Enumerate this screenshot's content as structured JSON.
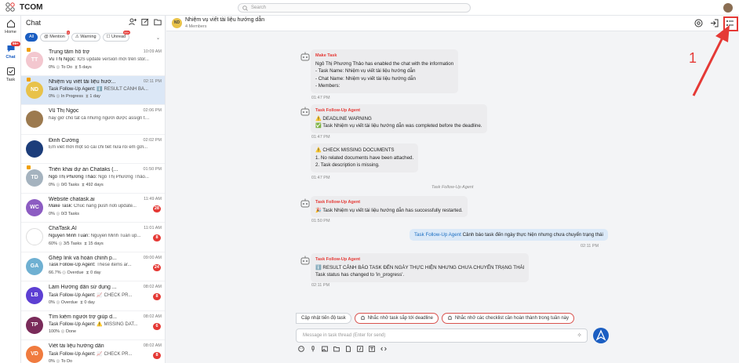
{
  "app": {
    "name": "TCOM",
    "search_placeholder": "Search"
  },
  "rail": [
    {
      "label": "Home"
    },
    {
      "label": "Chat",
      "badge": "99+"
    },
    {
      "label": "Task"
    }
  ],
  "sidebar": {
    "title": "Chat",
    "filters": [
      {
        "label": "All"
      },
      {
        "label": "Mention",
        "count": "0"
      },
      {
        "label": "Warning"
      },
      {
        "label": "Unread",
        "count": "99+"
      }
    ],
    "conversations": [
      {
        "initials": "TT",
        "color": "#f3c7cf",
        "name": "Trung tâm hỗ trợ",
        "time": "10:09 AM",
        "sender": "Vũ Thị Ngọc:",
        "preview": "IOS update version mới trên stor...",
        "pct": "0%",
        "status": "To Do",
        "due": "5 days"
      },
      {
        "initials": "ND",
        "color": "#e8c24a",
        "name": "Nhiệm vụ viết tài liệu hướ...",
        "time": "02:11 PM",
        "sender": "Task Follow-Up Agent:",
        "preview": "ℹ️ RESULT CẢNH BÁ...",
        "pct": "0%",
        "status": "In Progress",
        "due": "1 day"
      },
      {
        "initials": "",
        "color": "#9c7a4f",
        "name": "Vũ Thị Ngọc",
        "time": "02:06 PM",
        "sender": "",
        "preview": "hay giờ cho tất cả những người được assign tro...",
        "pct": "",
        "status": "",
        "due": ""
      },
      {
        "initials": "",
        "color": "#1c3d7a",
        "name": "Đinh Cường",
        "time": "02:02 PM",
        "sender": "",
        "preview": "Em viết mới một số cái chi tiết nữa rồi em gửi...",
        "pct": "",
        "status": "",
        "due": ""
      },
      {
        "initials": "TD",
        "color": "#a5b3bf",
        "name": "Triển khai dự án Chataks (...",
        "time": "01:50 PM",
        "sender": "Ngô Thị Phương Thảo:",
        "preview": "Ngô Thị Phương Thảo...",
        "pct": "0%",
        "status": "0/0 Tasks",
        "due": "492 days"
      },
      {
        "initials": "WC",
        "color": "#8c5cc2",
        "name": "Website chatask.ai",
        "time": "11:49 AM",
        "sender": "Make Task:",
        "preview": "Chúc năng push noti update...",
        "pct": "0%",
        "status": "0/3 Tasks",
        "due": "",
        "unread": "28"
      },
      {
        "initials": "",
        "color": "#ffffff",
        "name": "ChaTask.AI",
        "time": "11:01 AM",
        "sender": "Nguyễn Minh Tuấn:",
        "preview": "Nguyễn Minh Tuấn up...",
        "pct": "60%",
        "status": "3/5 Tasks",
        "due": "15 days",
        "unread": "8"
      },
      {
        "initials": "GA",
        "color": "#6fb0d2",
        "name": "Ghép link và hoàn chỉnh p...",
        "time": "09:00 AM",
        "sender": "Task Follow-Up Agent:",
        "preview": "These items ar...",
        "pct": "66.7%",
        "status": "Overdue",
        "due": "0 day",
        "unread": "24"
      },
      {
        "initials": "LB",
        "color": "#5d3fd3",
        "name": "Làm Hướng dẫn sử dụng ...",
        "time": "08:02 AM",
        "sender": "Task Follow-Up Agent:",
        "preview": "📈 CHECK PR...",
        "pct": "0%",
        "status": "Overdue",
        "due": "0 day",
        "unread": "8"
      },
      {
        "initials": "TP",
        "color": "#7a2b5a",
        "name": "Tìm kiếm người trợ giúp d...",
        "time": "08:02 AM",
        "sender": "Task Follow-Up Agent:",
        "preview": "⚠️ MISSING DAT...",
        "pct": "100%",
        "status": "Done",
        "due": "",
        "unread": "6"
      },
      {
        "initials": "VD",
        "color": "#f07b3f",
        "name": "Viết tài liệu hướng dẫn",
        "time": "08:02 AM",
        "sender": "Task Follow-Up Agent:",
        "preview": "📈 CHECK PR...",
        "pct": "0%",
        "status": "To Do",
        "due": "",
        "unread": "8"
      }
    ]
  },
  "chat": {
    "title": "Nhiệm vụ viết tài liệu hướng dẫn",
    "avatar": "ND",
    "members": "4 Members",
    "messages": [
      {
        "sender": "Make Task",
        "lines": [
          "Ngô Thị Phương Thảo has enabled the chat with the information",
          "- Task Name: Nhiệm vụ viết tài liệu hướng dẫn",
          "- Chat Name: Nhiệm vụ viết tài liệu hướng dẫn",
          "- Members:"
        ],
        "time": "01:47 PM"
      },
      {
        "sender": "Task Follow-Up Agent",
        "lines": [
          "⚠️ DEADLINE WARNING",
          "✅ Task Nhiệm vụ viết tài liệu hướng dẫn was completed before the deadline."
        ],
        "time": "01:47 PM"
      },
      {
        "sender": "",
        "lines": [
          "⚠️ CHECK MISSING DOCUMENTS",
          "1. No related documents have been attached.",
          "2. Task description is missing."
        ],
        "time": "01:47 PM"
      },
      {
        "system": "Task Follow-Up Agent"
      },
      {
        "sender": "Task Follow-Up Agent",
        "lines": [
          "🎉 Task Nhiệm vụ viết tài liệu hướng dẫn has successfully restarted."
        ],
        "time": "01:50 PM"
      },
      {
        "out_mention": "Task Follow-Up Agent",
        "out_text": "Cảnh báo task đến ngày thực hiện nhưng chưa chuyển trạng thái",
        "time": "02:11 PM"
      },
      {
        "sender": "Task Follow-Up Agent",
        "lines": [
          "ℹ️ RESULT CẢNH BÁO TASK ĐẾN NGÀY THỰC HIỆN NHƯNG CHƯA CHUYỂN TRẠNG THÁI",
          "Task status has changed to 'in_progress'."
        ],
        "time": "02:11 PM"
      }
    ],
    "suggestions": [
      "Cập nhật tiến độ task",
      "Nhắc nhở task sắp tới deadline",
      "Nhắc nhở các checklist cần hoàn thành trong tuần này"
    ],
    "composer_placeholder": "Message in task thread (Enter for send)"
  },
  "annotation": {
    "number": "1",
    "color": "#e53935"
  }
}
